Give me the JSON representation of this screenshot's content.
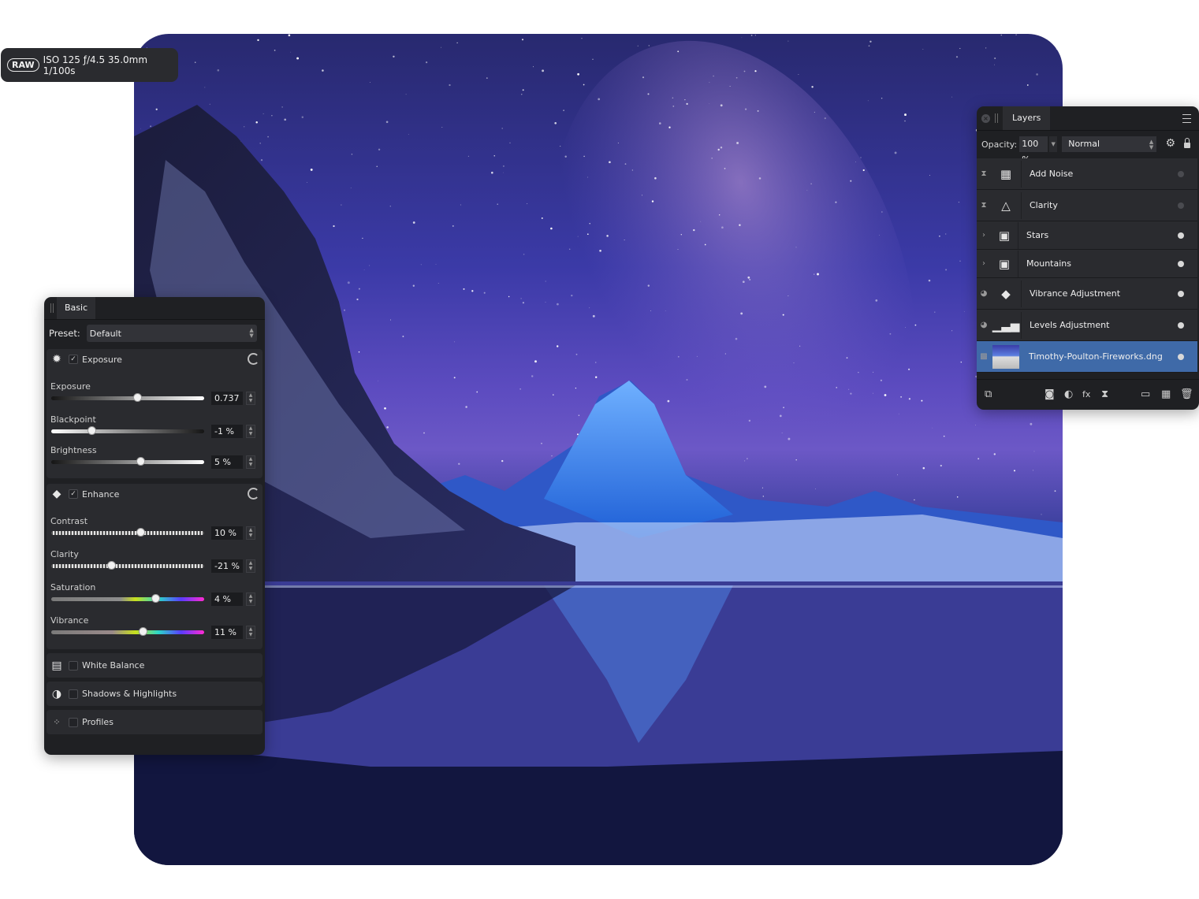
{
  "meta": {
    "raw_badge": "RAW",
    "exif": "ISO 125 ƒ/4.5 35.0mm 1/100s"
  },
  "basic_panel": {
    "tab": "Basic",
    "preset_label": "Preset:",
    "preset_value": "Default",
    "exposure_section": {
      "title": "Exposure",
      "enabled": true,
      "params": [
        {
          "name": "Exposure",
          "value": "0.737"
        },
        {
          "name": "Blackpoint",
          "value": "-1 %"
        },
        {
          "name": "Brightness",
          "value": "5 %"
        }
      ]
    },
    "enhance_section": {
      "title": "Enhance",
      "enabled": true,
      "params": [
        {
          "name": "Contrast",
          "value": "10 %"
        },
        {
          "name": "Clarity",
          "value": "-21 %"
        },
        {
          "name": "Saturation",
          "value": "4 %"
        },
        {
          "name": "Vibrance",
          "value": "11 %"
        }
      ]
    },
    "collapsed_sections": [
      "White Balance",
      "Shadows & Highlights",
      "Profiles"
    ]
  },
  "layers_panel": {
    "tab": "Layers",
    "opacity_label": "Opacity:",
    "opacity_value": "100 %",
    "blend_mode": "Normal",
    "layers": [
      {
        "name": "Add Noise",
        "icon": "noise-filter-icon",
        "visible": false,
        "selected": false
      },
      {
        "name": "Clarity",
        "icon": "clarity-filter-icon",
        "visible": false,
        "selected": false
      },
      {
        "name": "Stars",
        "icon": "pixel-group-icon",
        "visible": true,
        "selected": false
      },
      {
        "name": "Mountains",
        "icon": "pixel-group-icon",
        "visible": true,
        "selected": false
      },
      {
        "name": "Vibrance Adjustment",
        "icon": "vibrance-adjustment-icon",
        "visible": true,
        "selected": false
      },
      {
        "name": "Levels Adjustment",
        "icon": "levels-adjustment-icon",
        "visible": true,
        "selected": false
      },
      {
        "name": "Timothy-Poulton-Fireworks.dng",
        "icon": "image-thumbnail",
        "visible": true,
        "selected": true
      }
    ]
  }
}
